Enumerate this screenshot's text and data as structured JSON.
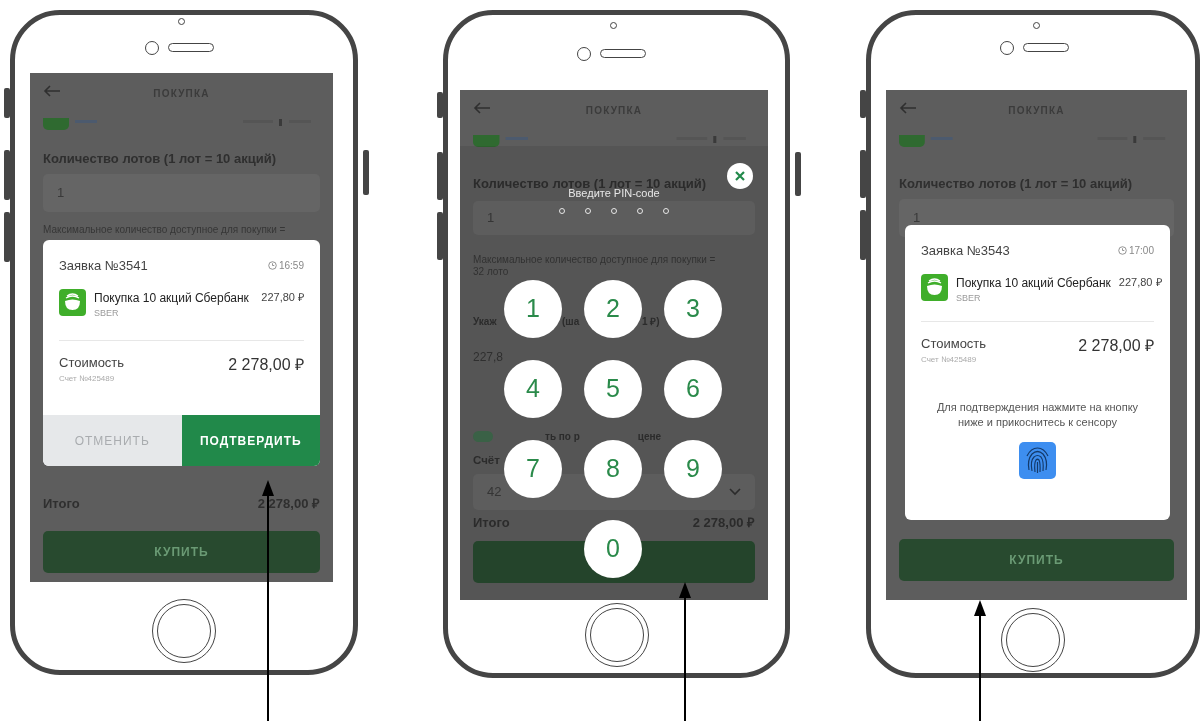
{
  "phones": [
    {
      "kind": "confirm_dialog",
      "screen": {
        "title": "ПОКУПКА",
        "lots_label": "Количество лотов (1 лот = 10 акций)",
        "lots_value": "1",
        "max_note": [
          "Максимальное количество доступное для покупки ="
        ],
        "total_label": "Итого",
        "total": "2 278,00 ₽",
        "buy_button": "КУПИТЬ"
      },
      "dialog": {
        "order": "Заявка №3541",
        "time": "16:59",
        "item": "Покупка 10 акций Сбербанк",
        "ticker": "SBER",
        "price": "227,80 ₽",
        "cost_label": "Стоимость",
        "account": "Счет №425489",
        "cost": "2 278,00 ₽",
        "buttons": [
          {
            "label": "ОТМЕНИТЬ",
            "kind": "cancel"
          },
          {
            "label": "ПОДТВЕРДИТЬ",
            "kind": "confirm"
          }
        ]
      }
    },
    {
      "kind": "pin_pad",
      "screen": {
        "title": "ПОКУПКА",
        "lots_label": "Количество лотов (1 лот = 10 акций)",
        "lots_value": "1",
        "max_note": [
          "Максимальное количество доступное для покупки =",
          "32 лото"
        ],
        "price_label_parts": [
          "Укаж",
          "(ша",
          "1 ₽)"
        ],
        "price_value": "227,8",
        "toggle": {
          "on": true
        },
        "toggle_label_parts": [
          "ть по р",
          "цене"
        ],
        "account_label": "Счёт",
        "account_value": "42",
        "total_label": "Итого",
        "total": "2 278,00 ₽"
      },
      "pin": {
        "prompt": "Введите PIN-code",
        "dots": [
          {
            "filled": false
          },
          {
            "filled": false
          },
          {
            "filled": false
          },
          {
            "filled": false
          },
          {
            "filled": false
          }
        ],
        "keys": [
          "1",
          "2",
          "3",
          "4",
          "5",
          "6",
          "7",
          "8",
          "9",
          "0"
        ]
      }
    },
    {
      "kind": "fingerprint_dialog",
      "screen": {
        "title": "ПОКУПКА",
        "lots_label": "Количество лотов (1 лот = 10 акций)",
        "lots_value": "1",
        "buy_button": "КУПИТЬ"
      },
      "dialog": {
        "order": "Заявка №3543",
        "time": "17:00",
        "item": "Покупка 10 акций Сбербанк",
        "ticker": "SBER",
        "price": "227,80 ₽",
        "cost_label": "Стоимость",
        "account": "Счет №425489",
        "cost": "2 278,00 ₽",
        "hint": "Для подтверждения нажмите на кнопку ниже и прикоснитесь к сенсору"
      }
    }
  ]
}
